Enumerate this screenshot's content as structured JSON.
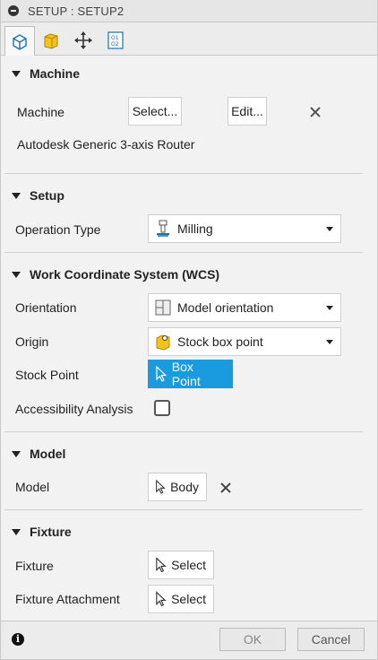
{
  "window": {
    "title": "SETUP : SETUP2"
  },
  "tabs": [
    {
      "name": "setup-tab",
      "icon": "cube-outline-icon",
      "active": true
    },
    {
      "name": "stock-tab",
      "icon": "yellow-cube-icon",
      "active": false
    },
    {
      "name": "post-process-tab",
      "icon": "move-arrows-icon",
      "active": false
    },
    {
      "name": "program-tab",
      "icon": "o1-o2-icon",
      "active": false
    }
  ],
  "machine": {
    "header": "Machine",
    "label": "Machine",
    "select_label": "Select...",
    "edit_label": "Edit...",
    "machine_name": "Autodesk Generic 3-axis Router"
  },
  "setup": {
    "header": "Setup",
    "operation_type_label": "Operation Type",
    "operation_type_value": "Milling"
  },
  "wcs": {
    "header": "Work Coordinate System (WCS)",
    "orientation_label": "Orientation",
    "orientation_value": "Model orientation",
    "origin_label": "Origin",
    "origin_value": "Stock box point",
    "stock_point_label": "Stock Point",
    "stock_point_button": "Box Point",
    "accessibility_label": "Accessibility Analysis",
    "accessibility_checked": false
  },
  "model": {
    "header": "Model",
    "label": "Model",
    "button": "Body"
  },
  "fixture": {
    "header": "Fixture",
    "fixture_label": "Fixture",
    "fixture_button": "Select",
    "attachment_label": "Fixture Attachment",
    "attachment_button": "Select"
  },
  "footer": {
    "ok_label": "OK",
    "cancel_label": "Cancel"
  },
  "colors": {
    "accent": "#1a9be0",
    "panel_bg": "#f2f2f2"
  }
}
